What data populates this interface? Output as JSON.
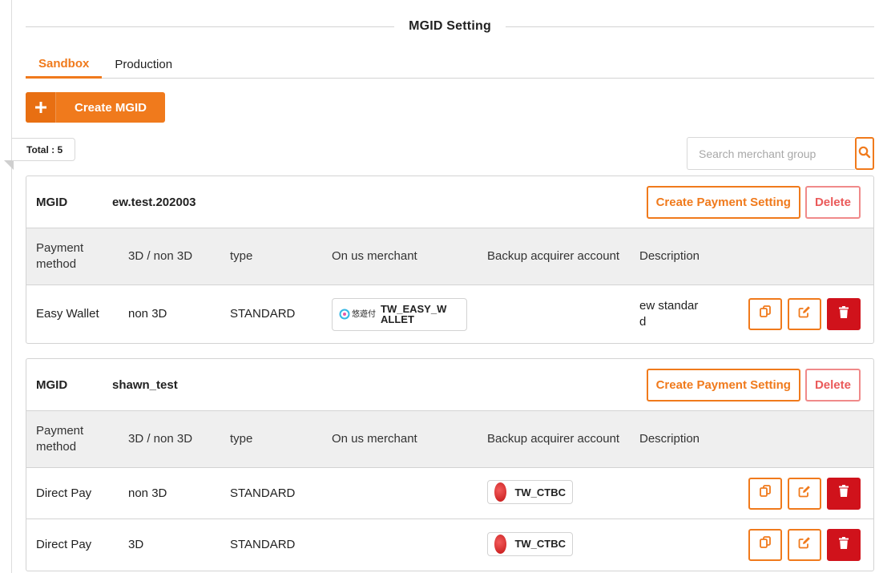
{
  "page": {
    "title": "MGID Setting",
    "tabs": [
      {
        "label": "Sandbox",
        "active": true
      },
      {
        "label": "Production",
        "active": false
      }
    ],
    "create_button": {
      "icon": "plus-icon",
      "label": "Create MGID"
    },
    "total": "Total : 5",
    "search": {
      "placeholder": "Search merchant group",
      "value": "",
      "icon": "search-icon"
    }
  },
  "colors": {
    "accent": "#f07a1c",
    "danger": "#d0121b",
    "delete_outline": "#ea5a5a",
    "header_bg": "#efefef"
  },
  "table_headers": {
    "payment_method": "Payment method",
    "secure": "3D / non 3D",
    "type": "type",
    "on_us": "On us merchant",
    "backup": "Backup acquirer account",
    "description": "Description"
  },
  "groups": [
    {
      "mgid_label": "MGID",
      "mgid": "ew.test.202003",
      "create_payment_label": "Create Payment Setting",
      "delete_label": "Delete",
      "rows": [
        {
          "method": "Easy Wallet",
          "secure": "non 3D",
          "type": "STANDARD",
          "on_us_logo_text": "悠遊付",
          "on_us": "TW_EASY_WALLET",
          "backup": "",
          "description": "ew standard"
        }
      ]
    },
    {
      "mgid_label": "MGID",
      "mgid": "shawn_test",
      "create_payment_label": "Create Payment Setting",
      "delete_label": "Delete",
      "rows": [
        {
          "method": "Direct Pay",
          "secure": "non 3D",
          "type": "STANDARD",
          "on_us": "",
          "backup": "TW_CTBC",
          "description": ""
        },
        {
          "method": "Direct Pay",
          "secure": "3D",
          "type": "STANDARD",
          "on_us": "",
          "backup": "TW_CTBC",
          "description": ""
        }
      ]
    }
  ],
  "row_action_icons": [
    "copy-icon",
    "edit-icon",
    "trash-icon"
  ]
}
